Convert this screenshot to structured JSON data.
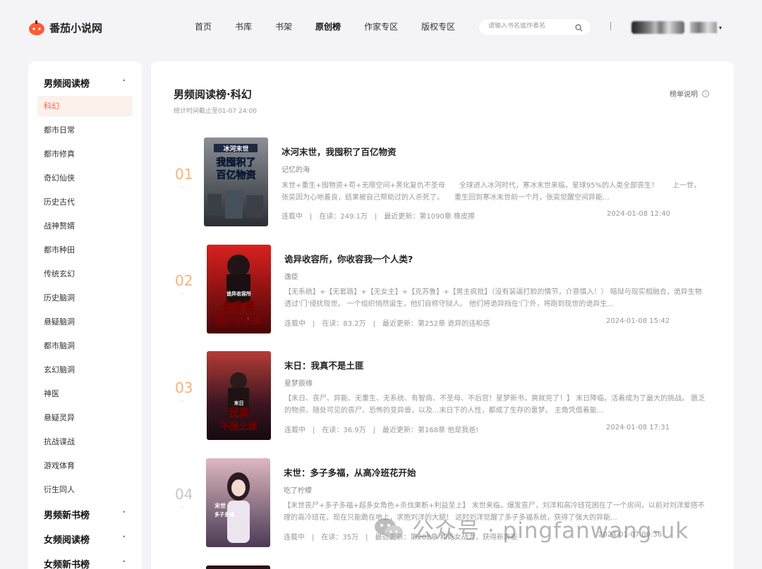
{
  "header": {
    "logo_text": "番茄小说网",
    "nav": [
      "首页",
      "书库",
      "书架",
      "原创榜",
      "作家专区",
      "版权专区"
    ],
    "nav_active": 3,
    "search_placeholder": "请输入书名或作者名"
  },
  "sidebar": {
    "groups": [
      {
        "label": "男频阅读榜",
        "chevron": "up"
      },
      {
        "label": "男频新书榜",
        "chevron": "down"
      },
      {
        "label": "女频阅读榜",
        "chevron": "down"
      },
      {
        "label": "女频新书榜",
        "chevron": "down"
      }
    ],
    "items": [
      "科幻",
      "都市日常",
      "都市修真",
      "奇幻仙侠",
      "历史古代",
      "战神赘婿",
      "都市种田",
      "传统玄幻",
      "历史脑洞",
      "悬疑脑洞",
      "都市脑洞",
      "玄幻脑洞",
      "神医",
      "悬疑灵异",
      "抗战谍战",
      "游戏体育",
      "衍生同人"
    ],
    "active_index": 0
  },
  "main": {
    "title": "男频阅读榜·科幻",
    "subtitle": "统计时间截止至01-07 24:00",
    "help_label": "榜单说明",
    "meta_labels": {
      "reading": "在读：",
      "update": "最近更新："
    },
    "books": [
      {
        "rank": "01",
        "title": "冰河末世，我囤积了百亿物资",
        "author": "记忆的海",
        "desc": "末世+重生+囤物资+苟+无限空间+黑化复仇不圣母　　全球进入冰河时代，寒冰末世来临，星球95%的人类全部丧生！　　上一世，张奕因为心地善良，结果被自己帮助过的人杀死了。　　重生回到寒冰末世前一个月，张奕觉醒空间异能...",
        "status": "连载中",
        "reading": "249.1万",
        "update": "第1090章 橡皮擦",
        "date": "2024-01-08 12:40",
        "cover_text": [
          "冰河末世",
          "我囤积了",
          "百亿物资"
        ],
        "cover_colors": [
          "#5b6068",
          "#2b2e33"
        ]
      },
      {
        "rank": "02",
        "title": "诡异收容所，你收容我一个人类?",
        "author": "逸臣",
        "desc": "【无系统】+【无套路】+【无女主】+【克苏鲁】+【男主疯批】（没有装逼打脸的情节，介意慎入！） 暗狱与现实相融合，诡异生物透过'门'侵扰现世。 一个组织悄然诞生，他们自称守狱人。 他们将诡异挡在'门'外，将跑到现世的诡异生...",
        "status": "连载中",
        "reading": "83.2万",
        "update": "第252章 诡异的违和感",
        "date": "2024-01-08 15:42",
        "cover_text": [
          "诡异收容所",
          "你收容",
          "我一个人类"
        ],
        "cover_colors": [
          "#c9161d",
          "#5a0508"
        ]
      },
      {
        "rank": "03",
        "title": "末日：我真不是土匪",
        "author": "星梦辰缘",
        "desc": "【末日、丧尸、异能、无重生、无系统、有智商、不圣母、不后宫！星梦新书，爽就完了！】 末日降临，活着成为了最大的挑战。 匮乏的物资、随处可见的丧尸、恐怖的变异兽，以及...末日下的人性，都成了生存的噩梦。 主角凭借着能...",
        "status": "连载中",
        "reading": "36.9万",
        "update": "第168章 他是我爸!",
        "date": "2024-01-08 17:31",
        "cover_text": [
          "末日",
          "我真",
          "不是土匪"
        ],
        "cover_colors": [
          "#b8342f",
          "#2a1018"
        ]
      },
      {
        "rank": "04",
        "title": "末世：多子多福，从高冷班花开始",
        "author": "吃了柠檬",
        "desc": "【末世丧尸+多子多福+超多女角色+杀伐果断+利益至上】 末世来临，爆发丧尸，刘洋和高冷班花困在了一个房间，以前对刘洋爱搭不理的高冷班花，现在只能跪在地上，求抱刘洋的大腿！ 这时刘洋觉醒了多子多福系统，获得了强大的异能...",
        "status": "连载中",
        "reading": "35万",
        "update": "第202章 和乾女战力，获得新异能",
        "date": "2024-01-07 09:36",
        "cover_text": [
          "末世",
          "多子多福"
        ],
        "cover_colors": [
          "#c7a1a8",
          "#4b3a55"
        ]
      }
    ]
  },
  "watermark": "公众号 · pingfanwang-uk",
  "colors": {
    "accent": "#fe5c35",
    "rank_hot": "#f3b47f",
    "rank_cold": "#c8c8c8"
  }
}
